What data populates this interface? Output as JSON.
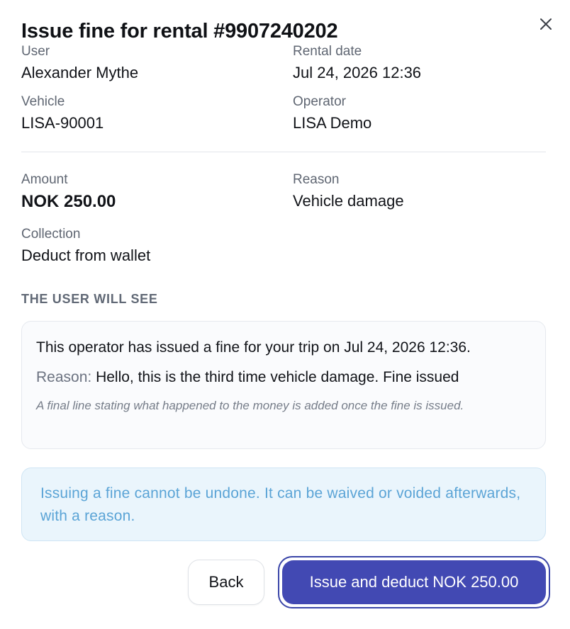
{
  "dialog": {
    "title": "Issue fine for rental #9907240202",
    "close_icon": "close-icon"
  },
  "details": {
    "user": {
      "label": "User",
      "value": "Alexander Mythe"
    },
    "rental_date": {
      "label": "Rental date",
      "value": "Jul 24, 2026 12:36"
    },
    "vehicle": {
      "label": "Vehicle",
      "value": "LISA-90001"
    },
    "operator": {
      "label": "Operator",
      "value": "LISA Demo"
    }
  },
  "fine": {
    "amount": {
      "label": "Amount",
      "value": "NOK 250.00"
    },
    "reason": {
      "label": "Reason",
      "value": "Vehicle damage"
    },
    "collection": {
      "label": "Collection",
      "value": "Deduct from wallet"
    }
  },
  "preview": {
    "heading": "THE USER WILL SEE",
    "message": "This operator has issued a fine for your trip on Jul 24, 2026 12:36.",
    "reason_label": "Reason:",
    "reason_text": "Hello, this is the third time vehicle damage. Fine issued",
    "note": "A final line stating what happened to the money is added once the fine is issued."
  },
  "info": {
    "text": "Issuing a fine cannot be undone. It can be waived or voided afterwards, with a reason."
  },
  "actions": {
    "back_label": "Back",
    "confirm_label": "Issue and deduct NOK 250.00"
  },
  "colors": {
    "primary": "#4249b3",
    "info_bg": "#eaf5fc",
    "info_text": "#5ba4d6"
  }
}
